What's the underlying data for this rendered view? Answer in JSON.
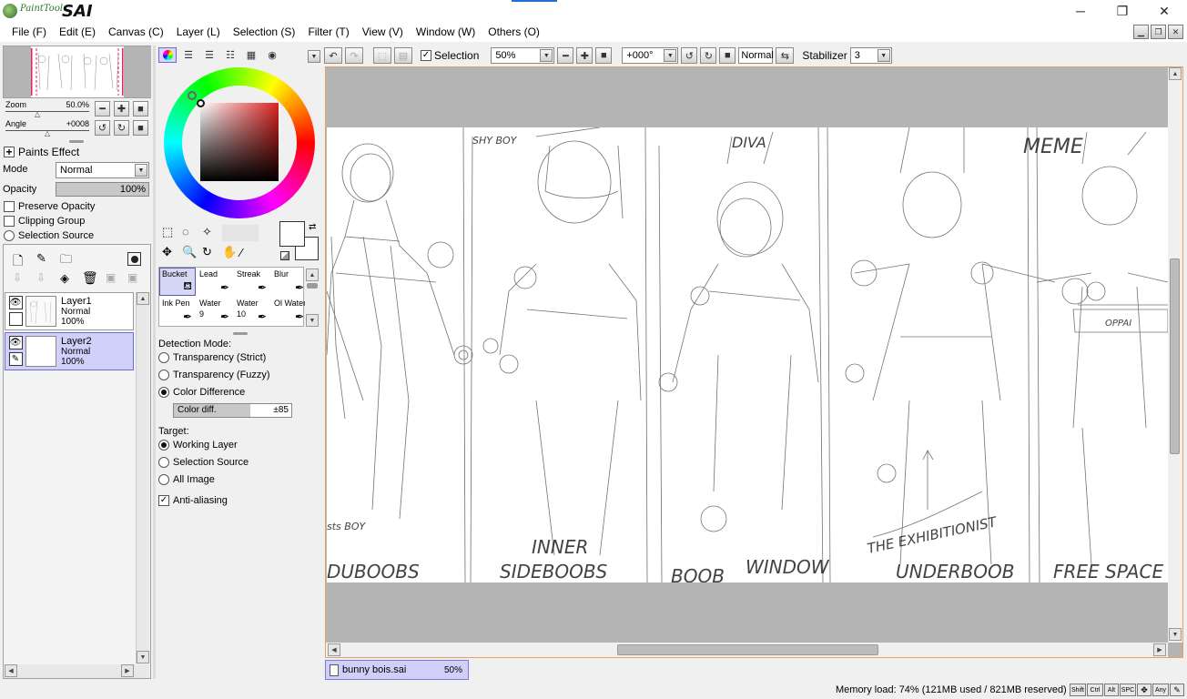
{
  "app": {
    "logo_small": "PaintTool",
    "logo_big": "SAI",
    "window_controls": {
      "minimize": "─",
      "maximize": "❐",
      "close": "✕"
    }
  },
  "menu": [
    "File (F)",
    "Edit (E)",
    "Canvas (C)",
    "Layer (L)",
    "Selection (S)",
    "Filter (T)",
    "View (V)",
    "Window (W)",
    "Others (O)"
  ],
  "navigator": {
    "zoom_label": "Zoom",
    "zoom_value": "50.0%",
    "angle_label": "Angle",
    "angle_value": "+0008"
  },
  "layer_props": {
    "paints_effect": "Paints Effect",
    "mode_label": "Mode",
    "mode_value": "Normal",
    "opacity_label": "Opacity",
    "opacity_value": "100%",
    "preserve_opacity": "Preserve Opacity",
    "clipping_group": "Clipping Group",
    "selection_source": "Selection Source"
  },
  "layers": [
    {
      "name": "Layer1",
      "mode": "Normal",
      "opacity": "100%",
      "active": false
    },
    {
      "name": "Layer2",
      "mode": "Normal",
      "opacity": "100%",
      "active": true
    }
  ],
  "tools": [
    {
      "name": "Bucket",
      "sub": "",
      "active": true
    },
    {
      "name": "Lead",
      "sub": "",
      "active": false
    },
    {
      "name": "Streak",
      "sub": "",
      "active": false
    },
    {
      "name": "Blur",
      "sub": "",
      "active": false
    },
    {
      "name": "Ink Pen",
      "sub": "",
      "active": false
    },
    {
      "name": "Water",
      "sub": "9",
      "active": false
    },
    {
      "name": "Water",
      "sub": "10",
      "active": false
    },
    {
      "name": "Ol Water",
      "sub": "",
      "active": false
    }
  ],
  "bucket_options": {
    "detection_mode_label": "Detection Mode:",
    "detection_modes": [
      "Transparency (Strict)",
      "Transparency (Fuzzy)",
      "Color Difference"
    ],
    "detection_selected": 2,
    "color_diff_label": "Color diff.",
    "color_diff_value": "±85",
    "target_label": "Target:",
    "targets": [
      "Working Layer",
      "Selection Source",
      "All Image"
    ],
    "target_selected": 0,
    "antialiasing": "Anti-aliasing"
  },
  "toolbar": {
    "selection_label": "Selection",
    "zoom_value": "50%",
    "angle_value": "+000°",
    "blend_mode": "Normal",
    "stabilizer_label": "Stabilizer",
    "stabilizer_value": "3"
  },
  "canvas": {
    "labels": [
      "SHY BOY",
      "DIVA",
      "MEME",
      "INNER",
      "SIDEBOOBS",
      "DUBOOBS",
      "BOOB",
      "WINDOW",
      "THE EXHIBITIONIST",
      "UNDERBOOB",
      "FREE SPACE",
      "OPPAI",
      "sts BOY"
    ]
  },
  "document_tab": {
    "name": "bunny bois.sai",
    "zoom": "50%"
  },
  "status": {
    "memory": "Memory load: 74% (121MB used / 821MB reserved)",
    "keys": [
      "Shift",
      "Ctrl",
      "Alt",
      "SPC",
      "✥",
      "Any",
      "✎"
    ]
  },
  "colors": {
    "accent_active": "#d0d0fa",
    "canvas_bg": "#b4b4b4",
    "canvas_border": "#e8a060"
  }
}
